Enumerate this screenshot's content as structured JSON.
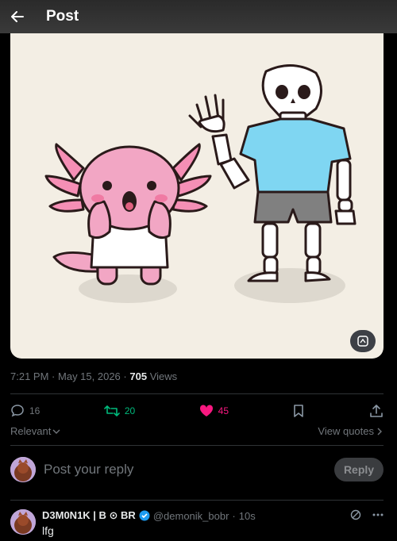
{
  "header": {
    "title": "Post",
    "back_icon": "arrow-left-icon"
  },
  "media": {
    "alt_icon": "alt-text-icon",
    "background": "#f3eee4"
  },
  "meta": {
    "time": "7:21 PM",
    "sep1": "·",
    "date": "May 15, 2026",
    "sep2": "·",
    "views_count": "705",
    "views_label": "Views"
  },
  "actions": {
    "replies": "16",
    "reposts": "20",
    "likes": "45",
    "colors": {
      "repost": "#00ba7c",
      "like": "#f91880"
    }
  },
  "sort": {
    "label": "Relevant"
  },
  "quotes": {
    "label": "View quotes"
  },
  "composer": {
    "placeholder": "Post your reply",
    "button": "Reply"
  },
  "comment": {
    "name": "D3M0N1K | B ⊙ BR",
    "handle": "@demonik_bobr",
    "sep": "·",
    "time": "10s",
    "text": "lfg",
    "verified_color": "#1d9bf0"
  }
}
